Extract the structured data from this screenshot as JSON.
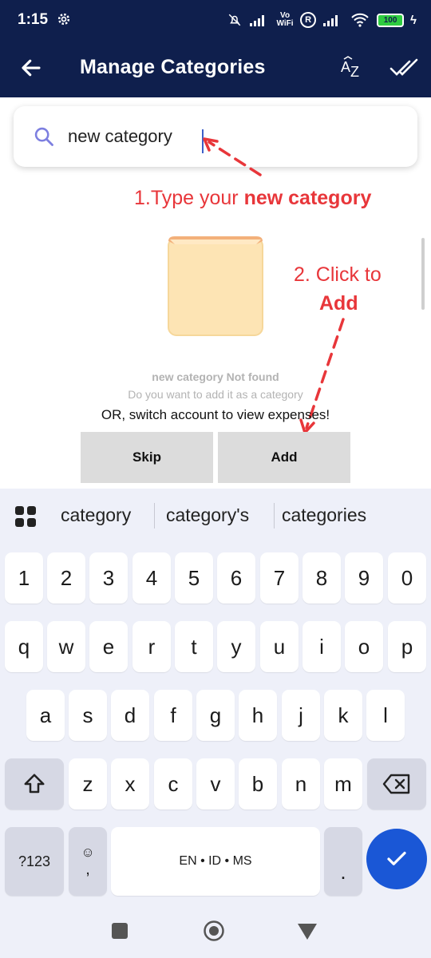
{
  "status_bar": {
    "time": "1:15",
    "vowifi": "Vo WiFi",
    "roaming": "R",
    "battery": "100"
  },
  "app_bar": {
    "title": "Manage Categories",
    "sort_label": "AZ"
  },
  "search": {
    "value": "new category",
    "placeholder": ""
  },
  "annotations": {
    "step1_prefix": "1.Type your ",
    "step1_bold": "new category",
    "step2_line1": "2. Click to",
    "step2_line2": "Add",
    "color": "#e8363a"
  },
  "empty_state": {
    "not_found": "new category Not found",
    "question": "Do you want to add it as a category",
    "switch_hint": "OR, switch account to view expenses!"
  },
  "actions": {
    "skip": "Skip",
    "add": "Add"
  },
  "keyboard": {
    "suggestions": [
      "category",
      "category's",
      "categories"
    ],
    "row_numbers": [
      "1",
      "2",
      "3",
      "4",
      "5",
      "6",
      "7",
      "8",
      "9",
      "0"
    ],
    "row1": [
      "q",
      "w",
      "e",
      "r",
      "t",
      "y",
      "u",
      "i",
      "o",
      "p"
    ],
    "row2": [
      "a",
      "s",
      "d",
      "f",
      "g",
      "h",
      "j",
      "k",
      "l"
    ],
    "row3": [
      "z",
      "x",
      "c",
      "v",
      "b",
      "n",
      "m"
    ],
    "symbols_key": "?123",
    "emoji_key": "☺",
    "comma_key": ",",
    "space_key": "EN • ID • MS",
    "period_key": ".",
    "enter_color": "#1a57d6"
  },
  "colors": {
    "app_bar": "#0f1f4d",
    "action_button": "#dcdcdc"
  }
}
